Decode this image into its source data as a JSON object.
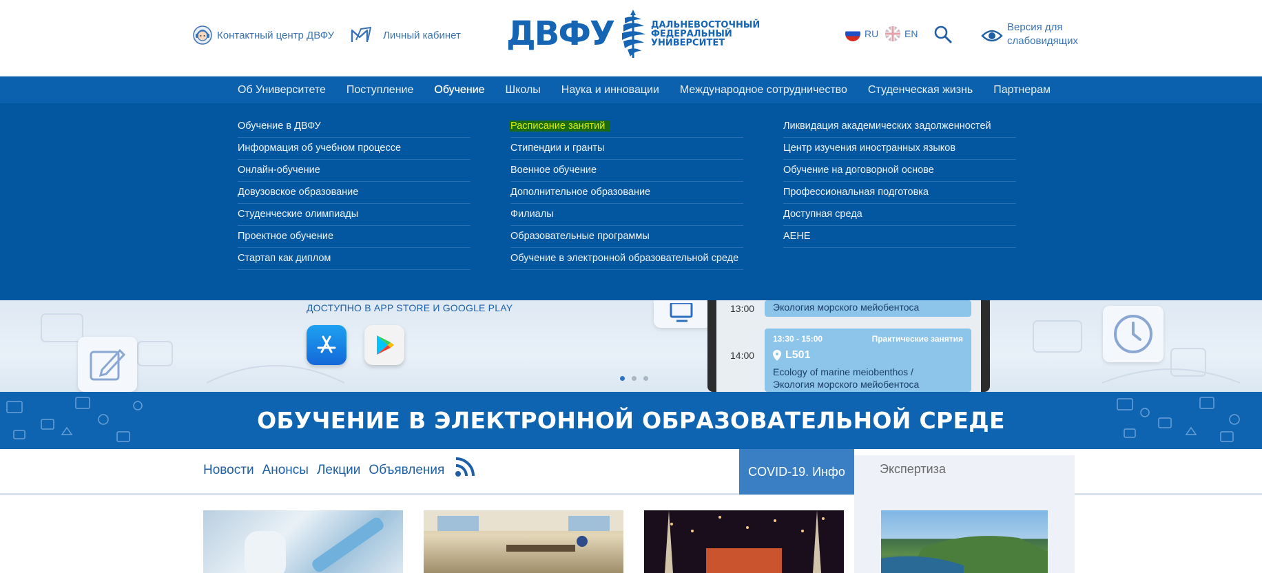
{
  "header": {
    "contact_center": "Контактный центр ДВФУ",
    "personal_account": "Личный кабинет",
    "logo_abbr": "ДВФУ",
    "logo_line1": "ДАЛЬНЕВОСТОЧНЫЙ",
    "logo_line2": "ФЕДЕРАЛЬНЫЙ",
    "logo_line3": "УНИВЕРСИТЕТ",
    "lang_ru": "RU",
    "lang_en": "EN",
    "vision_line1": "Версия для",
    "vision_line2": "слабовидящих"
  },
  "nav": {
    "items": [
      "Об Университете",
      "Поступление",
      "Обучение",
      "Школы",
      "Наука и инновации",
      "Международное сотрудничество",
      "Студенческая жизнь",
      "Партнерам"
    ],
    "active": "Обучение"
  },
  "dropdown": {
    "col1": [
      "Обучение в ДВФУ",
      "Информация об учебном процессе",
      "Онлайн-обучение",
      "Довузовское образование",
      "Студенческие олимпиады",
      "Проектное обучение",
      "Стартап как диплом"
    ],
    "col2": [
      "Расписание занятий",
      "Стипендии и гранты",
      "Военное обучение",
      "Дополнительное образование",
      "Филиалы",
      "Образовательные программы",
      "Обучение в электронной образовательной среде"
    ],
    "col3": [
      "Ликвидация академических задолженностей",
      "Центр изучения иностранных языков",
      "Обучение на договорной основе",
      "Профессиональная подготовка",
      "Доступная среда",
      "AEHE"
    ],
    "highlighted": "Расписание занятий"
  },
  "banner": {
    "available_text": "ДОСТУПНО В APP STORE И GOOGLE PLAY",
    "time1": "13:00",
    "time2": "14:00",
    "card1_text": "Экология морского мейобентоса",
    "card2_time": "13:30 - 15:00",
    "card2_type": "Практические занятия",
    "card2_room": "L501",
    "card2_text1": "Ecology of marine meiobenthos /",
    "card2_text2": "Экология морского мейобентоса"
  },
  "title_band": {
    "title": "ОБУЧЕНИЕ В ЭЛЕКТРОННОЙ ОБРАЗОВАТЕЛЬНОЙ СРЕДЕ"
  },
  "news": {
    "tabs": [
      "Новости",
      "Анонсы",
      "Лекции",
      "Объявления"
    ],
    "covid": "COVID-19. Инфо",
    "expertise": "Экспертиза"
  },
  "colors": {
    "brand": "#1565b4",
    "nav_bg": "#0b61ad",
    "dropdown_bg": "#0357a0",
    "highlight": "#d8f00a"
  },
  "slider": {
    "count": 3,
    "active_index": 0
  }
}
